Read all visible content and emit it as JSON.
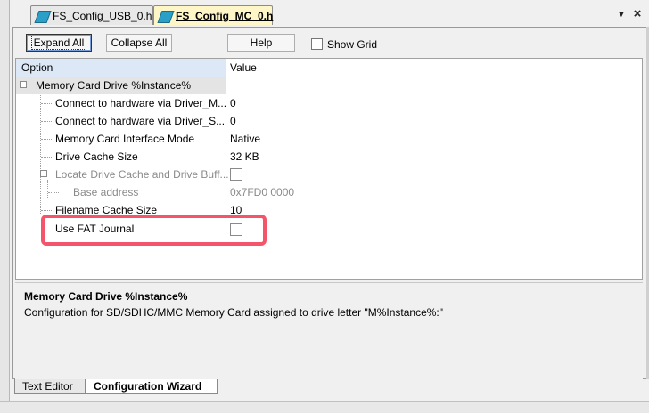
{
  "tabs": [
    {
      "label": "FS_Config_USB_0.h",
      "active": false
    },
    {
      "label": "FS_Config_MC_0.h",
      "active": true
    }
  ],
  "strip_controls": {
    "dropdown_icon": "▼",
    "close_icon": "×"
  },
  "toolbar": {
    "expand_all": "Expand All",
    "collapse_all": "Collapse All",
    "help": "Help",
    "show_grid": "Show Grid",
    "show_grid_checked": false
  },
  "grid": {
    "col_option": "Option",
    "col_value": "Value",
    "rows": [
      {
        "option": "Memory Card Drive %Instance%",
        "value": "",
        "type": "group"
      },
      {
        "option": "Connect to hardware via Driver_M...",
        "value": "0"
      },
      {
        "option": "Connect to hardware via Driver_S...",
        "value": "0"
      },
      {
        "option": "Memory Card Interface Mode",
        "value": "Native"
      },
      {
        "option": "Drive Cache Size",
        "value": "32 KB"
      },
      {
        "option": "Locate Drive Cache and Drive Buff...",
        "value": "",
        "type": "checkbox",
        "disabled": true
      },
      {
        "option": "Base address",
        "value": "0x7FD0 0000",
        "disabled": true
      },
      {
        "option": "Filename Cache Size",
        "value": "10"
      },
      {
        "option": "Use FAT Journal",
        "value": "",
        "type": "checkbox"
      }
    ]
  },
  "description": {
    "title": "Memory Card Drive %Instance%",
    "text": "Configuration for SD/SDHC/MMC Memory Card assigned to drive letter \"M%Instance%:\""
  },
  "bottom_tabs": [
    {
      "label": "Text Editor",
      "active": false
    },
    {
      "label": "Configuration Wizard",
      "active": true
    }
  ]
}
